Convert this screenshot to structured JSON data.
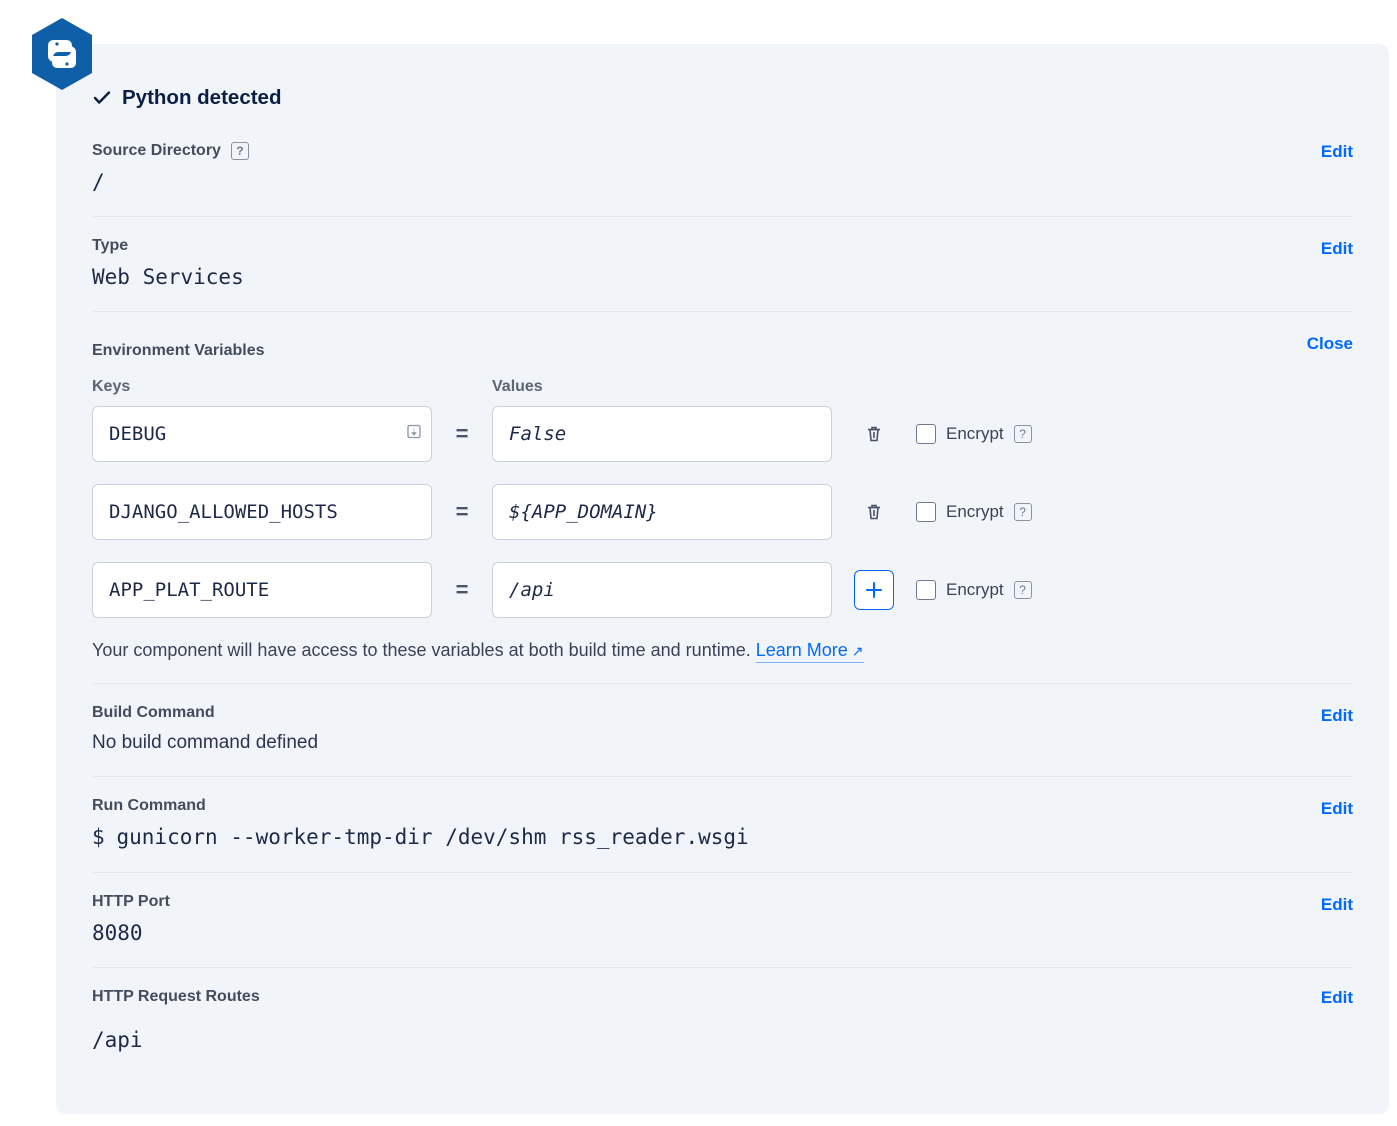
{
  "header": {
    "detected_title": "Python detected"
  },
  "source_directory": {
    "label": "Source Directory",
    "value": "/",
    "edit": "Edit"
  },
  "type": {
    "label": "Type",
    "value": "Web Services",
    "edit": "Edit"
  },
  "env_vars": {
    "label": "Environment Variables",
    "close": "Close",
    "keys_header": "Keys",
    "values_header": "Values",
    "eq": "=",
    "encrypt_label": "Encrypt",
    "rows": [
      {
        "key": "DEBUG",
        "value": "False",
        "action": "delete",
        "show_key_icon": true
      },
      {
        "key": "DJANGO_ALLOWED_HOSTS",
        "value": "${APP_DOMAIN}",
        "action": "delete",
        "show_key_icon": false
      },
      {
        "key": "APP_PLAT_ROUTE",
        "value": "/api",
        "action": "add",
        "show_key_icon": false
      }
    ],
    "note_text": "Your component will have access to these variables at both build time and runtime. ",
    "learn_more": "Learn More"
  },
  "build_command": {
    "label": "Build Command",
    "value": "No build command defined",
    "edit": "Edit"
  },
  "run_command": {
    "label": "Run Command",
    "prompt": "$",
    "value": "gunicorn --worker-tmp-dir /dev/shm rss_reader.wsgi",
    "edit": "Edit"
  },
  "http_port": {
    "label": "HTTP Port",
    "value": "8080",
    "edit": "Edit"
  },
  "http_routes": {
    "label": "HTTP Request Routes",
    "value": "/api",
    "edit": "Edit"
  }
}
